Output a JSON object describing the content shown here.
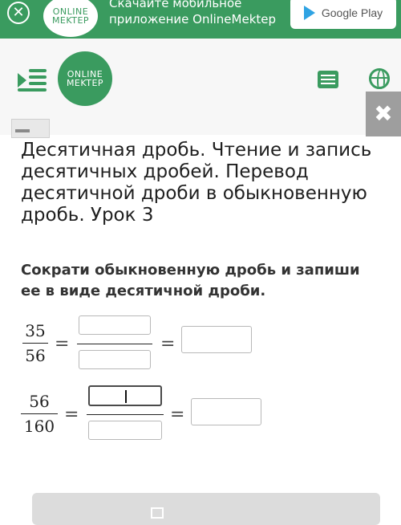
{
  "banner": {
    "close_glyph": "✕",
    "logo_line1": "ONLINE",
    "logo_line2": "MEKTEP",
    "text": "Скачайте мобильное приложение OnlineMektep",
    "store_label": "Google Play"
  },
  "header": {
    "logo_line1": "ONLINE",
    "logo_line2": "MEKTEP",
    "close_glyph": "✖"
  },
  "lesson": {
    "title": "Десятичная дробь. Чтение и запись десятичных дробей. Перевод десятичной дроби в обыкновенную дробь. Урок 3"
  },
  "task": {
    "instruction": "Сократи обыкновенную дробь и запиши ее в виде десятичной дроби.",
    "rows": [
      {
        "numerator": "35",
        "denominator": "56",
        "eq1": "=",
        "eq2": "="
      },
      {
        "numerator": "56",
        "denominator": "160",
        "eq1": "=",
        "eq2": "="
      }
    ]
  },
  "colors": {
    "brand_green": "#3a9b5f",
    "button_gray": "#dcdcdc"
  },
  "icons": [
    "close-icon",
    "google-play-icon",
    "menu-icon",
    "list-icon",
    "globe-icon",
    "edit-icon"
  ]
}
